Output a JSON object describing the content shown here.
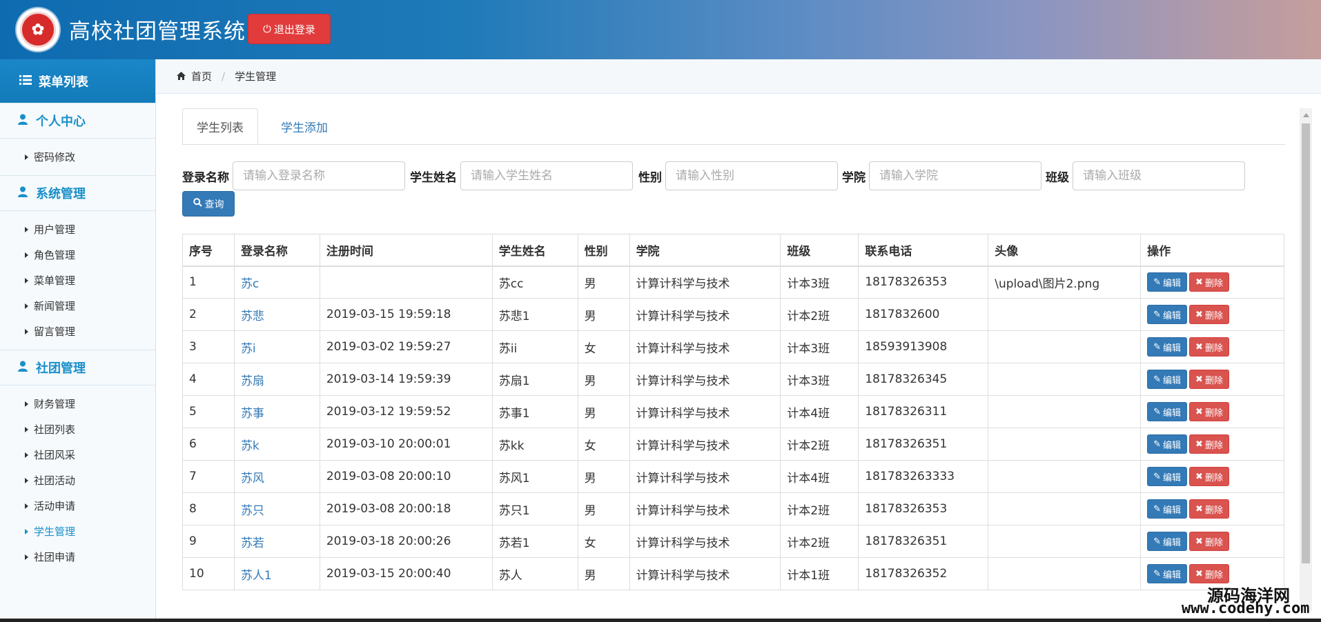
{
  "header": {
    "title": "高校社团管理系统",
    "logout_label": "退出登录"
  },
  "sidebar": {
    "menu_title": "菜单列表",
    "groups": [
      {
        "title": "个人中心",
        "items": [
          "密码修改"
        ]
      },
      {
        "title": "系统管理",
        "items": [
          "用户管理",
          "角色管理",
          "菜单管理",
          "新闻管理",
          "留言管理"
        ]
      },
      {
        "title": "社团管理",
        "items": [
          "财务管理",
          "社团列表",
          "社团风采",
          "社团活动",
          "活动申请",
          "学生管理",
          "社团申请"
        ]
      }
    ],
    "active_item": "学生管理"
  },
  "breadcrumb": {
    "home": "首页",
    "current": "学生管理"
  },
  "tabs": {
    "list": "学生列表",
    "add": "学生添加"
  },
  "filters": {
    "login_label": "登录名称",
    "login_placeholder": "请输入登录名称",
    "name_label": "学生姓名",
    "name_placeholder": "请输入学生姓名",
    "gender_label": "性别",
    "gender_placeholder": "请输入性别",
    "college_label": "学院",
    "college_placeholder": "请输入学院",
    "class_label": "班级",
    "class_placeholder": "请输入班级",
    "query_label": "查询"
  },
  "table": {
    "headers": [
      "序号",
      "登录名称",
      "注册时间",
      "学生姓名",
      "性别",
      "学院",
      "班级",
      "联系电话",
      "头像",
      "操作"
    ],
    "edit_label": "编辑",
    "delete_label": "删除",
    "rows": [
      [
        "1",
        "苏c",
        "",
        "苏cc",
        "男",
        "计算计科学与技术",
        "计本3班",
        "18178326353",
        "\\upload\\图片2.png"
      ],
      [
        "2",
        "苏悲",
        "2019-03-15 19:59:18",
        "苏悲1",
        "男",
        "计算计科学与技术",
        "计本2班",
        "1817832600",
        ""
      ],
      [
        "3",
        "苏i",
        "2019-03-02 19:59:27",
        "苏ii",
        "女",
        "计算计科学与技术",
        "计本3班",
        "18593913908",
        ""
      ],
      [
        "4",
        "苏扇",
        "2019-03-14 19:59:39",
        "苏扇1",
        "男",
        "计算计科学与技术",
        "计本3班",
        "18178326345",
        ""
      ],
      [
        "5",
        "苏事",
        "2019-03-12 19:59:52",
        "苏事1",
        "男",
        "计算计科学与技术",
        "计本4班",
        "18178326311",
        ""
      ],
      [
        "6",
        "苏k",
        "2019-03-10 20:00:01",
        "苏kk",
        "女",
        "计算计科学与技术",
        "计本2班",
        "18178326351",
        ""
      ],
      [
        "7",
        "苏风",
        "2019-03-08 20:00:10",
        "苏风1",
        "男",
        "计算计科学与技术",
        "计本4班",
        "181783263333",
        ""
      ],
      [
        "8",
        "苏只",
        "2019-03-08 20:00:18",
        "苏只1",
        "男",
        "计算计科学与技术",
        "计本2班",
        "18178326353",
        ""
      ],
      [
        "9",
        "苏若",
        "2019-03-18 20:00:26",
        "苏若1",
        "女",
        "计算计科学与技术",
        "计本2班",
        "18178326351",
        ""
      ],
      [
        "10",
        "苏人1",
        "2019-03-15 20:00:40",
        "苏人",
        "男",
        "计算计科学与技术",
        "计本1班",
        "18178326352",
        ""
      ]
    ]
  },
  "watermark": {
    "line1": "源码海洋网",
    "line2": "www.codehy.com"
  },
  "colors": {
    "primary": "#337ab7",
    "danger": "#d9534f",
    "sidebar_accent": "#1a8fc9"
  }
}
